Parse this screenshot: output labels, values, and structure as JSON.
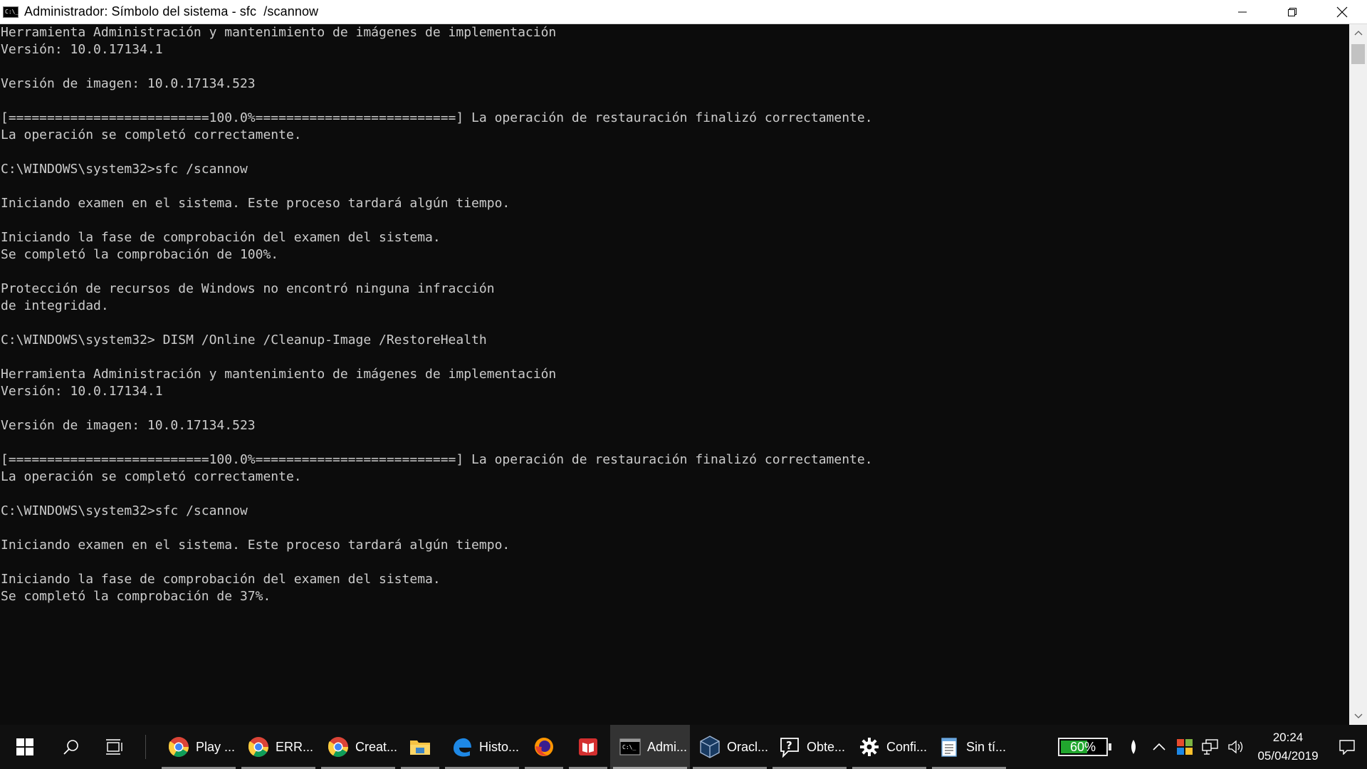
{
  "window": {
    "title": "Administrador: Símbolo del sistema - sfc  /scannow",
    "icon": "cmd-icon",
    "icon_text": "C:\\_",
    "controls": [
      "minimize",
      "maximize",
      "close"
    ]
  },
  "console": {
    "lines": [
      "Herramienta Administración y mantenimiento de imágenes de implementación",
      "Versión: 10.0.17134.1",
      "",
      "Versión de imagen: 10.0.17134.523",
      "",
      "[==========================100.0%==========================] La operación de restauración finalizó correctamente.",
      "La operación se completó correctamente.",
      "",
      "C:\\WINDOWS\\system32>sfc /scannow",
      "",
      "Iniciando examen en el sistema. Este proceso tardará algún tiempo.",
      "",
      "Iniciando la fase de comprobación del examen del sistema.",
      "Se completó la comprobación de 100%.",
      "",
      "Protección de recursos de Windows no encontró ninguna infracción",
      "de integridad.",
      "",
      "C:\\WINDOWS\\system32> DISM /Online /Cleanup-Image /RestoreHealth",
      "",
      "Herramienta Administración y mantenimiento de imágenes de implementación",
      "Versión: 10.0.17134.1",
      "",
      "Versión de imagen: 10.0.17134.523",
      "",
      "[==========================100.0%==========================] La operación de restauración finalizó correctamente.",
      "La operación se completó correctamente.",
      "",
      "C:\\WINDOWS\\system32>sfc /scannow",
      "",
      "Iniciando examen en el sistema. Este proceso tardará algún tiempo.",
      "",
      "Iniciando la fase de comprobación del examen del sistema.",
      "Se completó la comprobación de 37%."
    ],
    "foreground": "#cccccc",
    "background": "#0c0c0c"
  },
  "taskbar": {
    "apps": [
      {
        "name": "chrome-play",
        "icon": "chrome-icon",
        "label": "Play ..."
      },
      {
        "name": "chrome-err",
        "icon": "chrome-icon",
        "label": "ERR..."
      },
      {
        "name": "chrome-creat",
        "icon": "chrome-icon",
        "label": "Creat..."
      },
      {
        "name": "file-explorer",
        "icon": "folder-icon",
        "label": ""
      },
      {
        "name": "edge-histo",
        "icon": "edge-icon",
        "label": "Histo..."
      },
      {
        "name": "firefox",
        "icon": "firefox-icon",
        "label": ""
      },
      {
        "name": "book-app",
        "icon": "book-icon",
        "label": ""
      },
      {
        "name": "cmd-admin",
        "icon": "cmd-icon",
        "label": "Admi...",
        "active": true
      },
      {
        "name": "virtualbox-oracle",
        "icon": "virtualbox-icon",
        "label": "Oracl..."
      },
      {
        "name": "get-help",
        "icon": "help-icon",
        "label": "Obte..."
      },
      {
        "name": "settings",
        "icon": "gear-icon",
        "label": "Confi..."
      },
      {
        "name": "notepad",
        "icon": "notepad-icon",
        "label": "Sin tí..."
      }
    ],
    "battery": {
      "label": "60%",
      "level": 0.6,
      "color": "#21a62e"
    },
    "clock": {
      "time": "20:24",
      "date": "05/04/2019"
    }
  }
}
